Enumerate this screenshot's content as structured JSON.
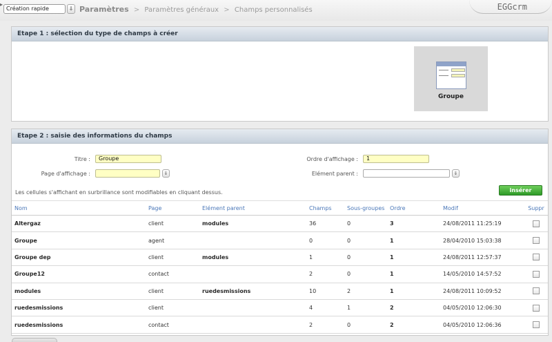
{
  "topbar": {
    "edge_arrow": "▸",
    "quick_create": "Création rapide",
    "dropdown_arrow": "⇓",
    "breadcrumb": [
      "Paramètres",
      "Paramètres généraux",
      "Champs personnalisés"
    ],
    "separator": ">",
    "logo": "EGGcrm"
  },
  "step1": {
    "title": "Etape 1 : sélection du type de champs à créer",
    "type_label": "Groupe"
  },
  "step2": {
    "title": "Etape 2 : saisie des informations du champs",
    "titre_label": "Titre :",
    "titre_value": "Groupe",
    "page_label": "Page d'affichage :",
    "page_value": "",
    "ordre_label": "Ordre d'affichage :",
    "ordre_value": "1",
    "parent_label": "Elément parent :",
    "parent_value": "",
    "dropdown_arrow": "⇓",
    "hint": "Les cellules s'affichant en surbrillance sont modifiables en cliquant dessus.",
    "insert_label": "insérer"
  },
  "table": {
    "headers": [
      "Nom",
      "Page",
      "Elément parent",
      "Champs",
      "Sous-groupes",
      "Ordre",
      "Modif",
      "Suppr"
    ],
    "rows": [
      [
        "Altergaz",
        "client",
        "modules",
        "36",
        "0",
        "3",
        "24/08/2011 11:25:19"
      ],
      [
        "Groupe",
        "agent",
        "",
        "0",
        "0",
        "1",
        "28/04/2010 15:03:38"
      ],
      [
        "Groupe dep",
        "client",
        "modules",
        "1",
        "0",
        "1",
        "24/08/2011 12:57:37"
      ],
      [
        "Groupe12",
        "contact",
        "",
        "2",
        "0",
        "1",
        "14/05/2010 14:57:52"
      ],
      [
        "modules",
        "client",
        "ruedesmissions",
        "10",
        "2",
        "1",
        "24/08/2011 10:09:52"
      ],
      [
        "ruedesmissions",
        "client",
        "",
        "4",
        "1",
        "2",
        "04/05/2010 12:06:30"
      ],
      [
        "ruedesmissions",
        "contact",
        "",
        "2",
        "0",
        "2",
        "04/05/2010 12:06:36"
      ]
    ]
  }
}
